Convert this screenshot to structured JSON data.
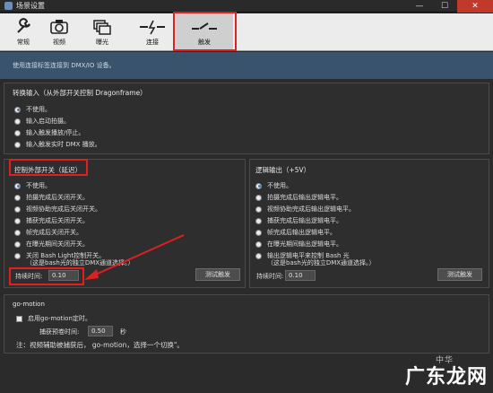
{
  "window": {
    "title": "场景设置",
    "min": "—",
    "max": "☐",
    "close": "✕"
  },
  "toolbar": {
    "items": [
      {
        "label": "常规",
        "icon": "wrench-icon"
      },
      {
        "label": "视频",
        "icon": "camera-icon"
      },
      {
        "label": "曝光",
        "icon": "layers-icon"
      },
      {
        "label": "连接",
        "icon": "plug-icon"
      },
      {
        "label": "触发",
        "icon": "switch-icon"
      }
    ],
    "active": "触发"
  },
  "info": {
    "text": "使用连接标签连接到 DMX/IO 设备。"
  },
  "convert": {
    "title": "转换输入（从外部开关控制 Dragonframe）",
    "options": [
      "不使用。",
      "输入启动拍摄。",
      "输入触发播放/停止。",
      "输入触发实时 DMX 播放。"
    ],
    "selected": 0
  },
  "external": {
    "title": "控制外部开关（延迟）",
    "options": [
      "不使用。",
      "拍摄完成后关闭开关。",
      "视频协助完成后关闭开关。",
      "捕获完成后关闭开关。",
      "帧完成后关闭开关。",
      "在曝光期间关闭开关。"
    ],
    "bash_line1": "关闭 Bash Light控制开关。",
    "bash_line2": "（这是bash光的独立DMX通道选择。）",
    "selected": 0,
    "duration_label": "持续时间:",
    "duration_value": "0.10",
    "test_button": "测试触发"
  },
  "logic": {
    "title": "逻辑输出（+5V）",
    "options": [
      "不使用。",
      "拍摄完成后输出逻辑电平。",
      "视频协助完成后输出逻辑电平。",
      "捕获完成后输出逻辑电平。",
      "帧完成后输出逻辑电平。",
      "在曝光期间输出逻辑电平。"
    ],
    "bash_line1": "输出逻辑电平来控制 Bash 光",
    "bash_line2": "（这是bash光的独立DMX通道选择。）",
    "selected": 0,
    "duration_label": "持续时间:",
    "duration_value": "0.10",
    "test_button": "测试触发"
  },
  "gomotion": {
    "title": "go-motion",
    "enable_label": "启用go-motion定时。",
    "capture_label": "捕获预卷时间:",
    "capture_value": "0.50",
    "capture_unit": "秒",
    "note": "注：视频辅助被捕获后， go-motion，选择一个切换\"。"
  },
  "watermark": {
    "text": "广东龙网",
    "sub": "中华"
  },
  "colors": {
    "accent": "#3d7cc9",
    "highlight": "#e02020",
    "info_bar": "#38536b"
  }
}
